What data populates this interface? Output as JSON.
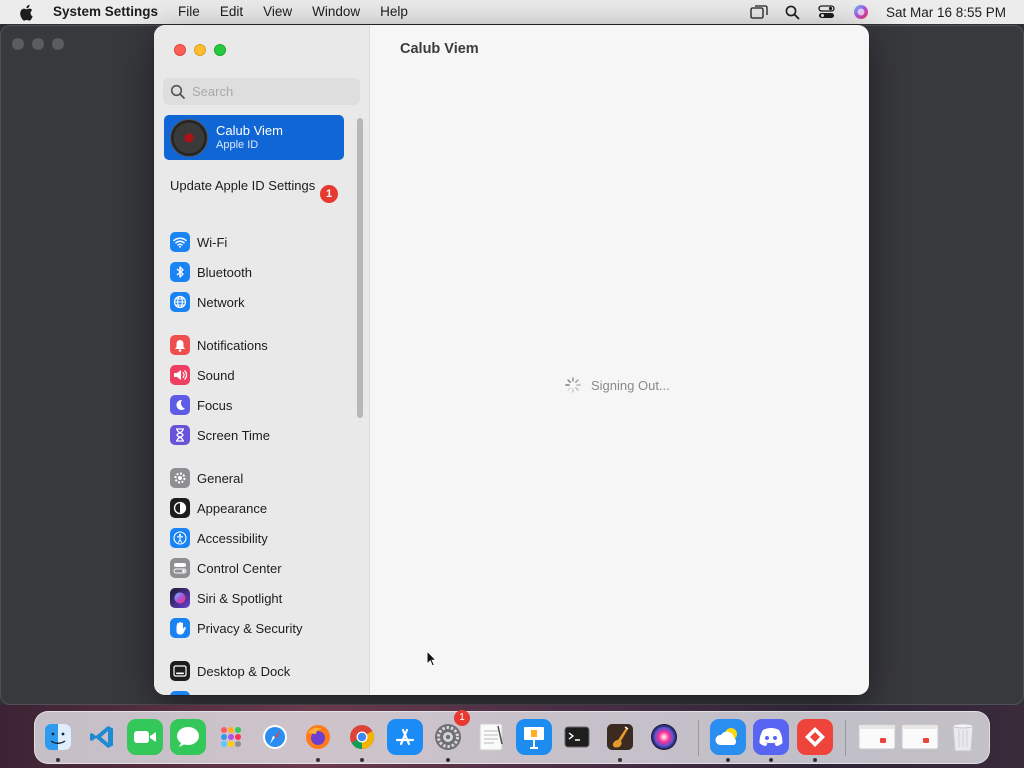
{
  "menubar": {
    "app_name": "System Settings",
    "items": [
      "File",
      "Edit",
      "View",
      "Window",
      "Help"
    ],
    "clock": "Sat Mar 16  8:55 PM"
  },
  "window": {
    "title": "Calub Viem",
    "search_placeholder": "Search",
    "account": {
      "name": "Calub Viem",
      "subtitle": "Apple ID"
    },
    "update": {
      "label": "Update Apple ID Settings",
      "badge": "1"
    },
    "sidebar_items": [
      {
        "label": "Wi-Fi",
        "icon": "wifi-icon",
        "color": "#1a84f5"
      },
      {
        "label": "Bluetooth",
        "icon": "bluetooth-icon",
        "color": "#1a84f5"
      },
      {
        "label": "Network",
        "icon": "globe-icon",
        "color": "#1a84f5"
      },
      {
        "label": "Notifications",
        "icon": "bell-icon",
        "color": "#ef4e4e"
      },
      {
        "label": "Sound",
        "icon": "speaker-icon",
        "color": "#ee3f62"
      },
      {
        "label": "Focus",
        "icon": "moon-icon",
        "color": "#5e5ce6"
      },
      {
        "label": "Screen Time",
        "icon": "hourglass-icon",
        "color": "#6753d8"
      },
      {
        "label": "General",
        "icon": "gear-icon",
        "color": "#8e8e93"
      },
      {
        "label": "Appearance",
        "icon": "appearance-icon",
        "color": "#1d1d1f"
      },
      {
        "label": "Accessibility",
        "icon": "accessibility-icon",
        "color": "#1a84f5"
      },
      {
        "label": "Control Center",
        "icon": "control-center-icon",
        "color": "#8e8e93"
      },
      {
        "label": "Siri & Spotlight",
        "icon": "siri-icon",
        "color": "#6a3fd6"
      },
      {
        "label": "Privacy & Security",
        "icon": "hand-icon",
        "color": "#1a84f5"
      },
      {
        "label": "Desktop & Dock",
        "icon": "dock-icon",
        "color": "#1d1d1f"
      }
    ],
    "status_text": "Signing Out..."
  },
  "dock": {
    "apps": [
      {
        "name": "Finder",
        "icon": "finder-icon",
        "color": "#2d9cf0",
        "running": true
      },
      {
        "name": "Visual Studio Code",
        "icon": "vscode-icon",
        "color": "#ffffff",
        "running": false
      },
      {
        "name": "FaceTime",
        "icon": "facetime-icon",
        "color": "#34c759",
        "running": false
      },
      {
        "name": "Messages",
        "icon": "messages-icon",
        "color": "#34c759",
        "running": false
      },
      {
        "name": "Launchpad",
        "icon": "launchpad-icon",
        "color": "#e7e7ec",
        "running": false
      },
      {
        "name": "Safari",
        "icon": "safari-icon",
        "color": "#1e88f0",
        "running": false
      },
      {
        "name": "Firefox",
        "icon": "firefox-icon",
        "color": "#6b3fd1",
        "running": true
      },
      {
        "name": "Chrome",
        "icon": "chrome-icon",
        "color": "#ffffff",
        "running": true
      },
      {
        "name": "App Store",
        "icon": "appstore-icon",
        "color": "#1b8bf5",
        "running": false
      },
      {
        "name": "System Settings",
        "icon": "settings-icon",
        "color": "#8e8e93",
        "running": true,
        "badge": "1"
      },
      {
        "name": "TextEdit",
        "icon": "textedit-icon",
        "color": "#f5f5f5",
        "running": false
      },
      {
        "name": "Keynote",
        "icon": "keynote-icon",
        "color": "#1d8cf0",
        "running": false
      },
      {
        "name": "Terminal",
        "icon": "terminal-icon",
        "color": "#1e1e1e",
        "running": false
      },
      {
        "name": "GarageBand",
        "icon": "garageband-icon",
        "color": "#3a2a20",
        "running": true
      },
      {
        "name": "Siri",
        "icon": "siri-icon",
        "color": "#1a1a2e",
        "running": false
      },
      {
        "name": "Weather",
        "icon": "weather-icon",
        "color": "#2a8ef0",
        "running": true
      },
      {
        "name": "Discord",
        "icon": "discord-icon",
        "color": "#5865f2",
        "running": true
      },
      {
        "name": "AnyDesk",
        "icon": "anydesk-icon",
        "color": "#ef443b",
        "running": true
      },
      {
        "name": "Recent Window 1",
        "icon": "window-thumbnail-icon",
        "color": "#f0f0f0",
        "running": false
      },
      {
        "name": "Recent Window 2",
        "icon": "window-thumbnail-icon",
        "color": "#f0f0f0",
        "running": false
      },
      {
        "name": "Trash",
        "icon": "trash-icon",
        "color": "#e8e8ec",
        "running": false
      }
    ]
  }
}
